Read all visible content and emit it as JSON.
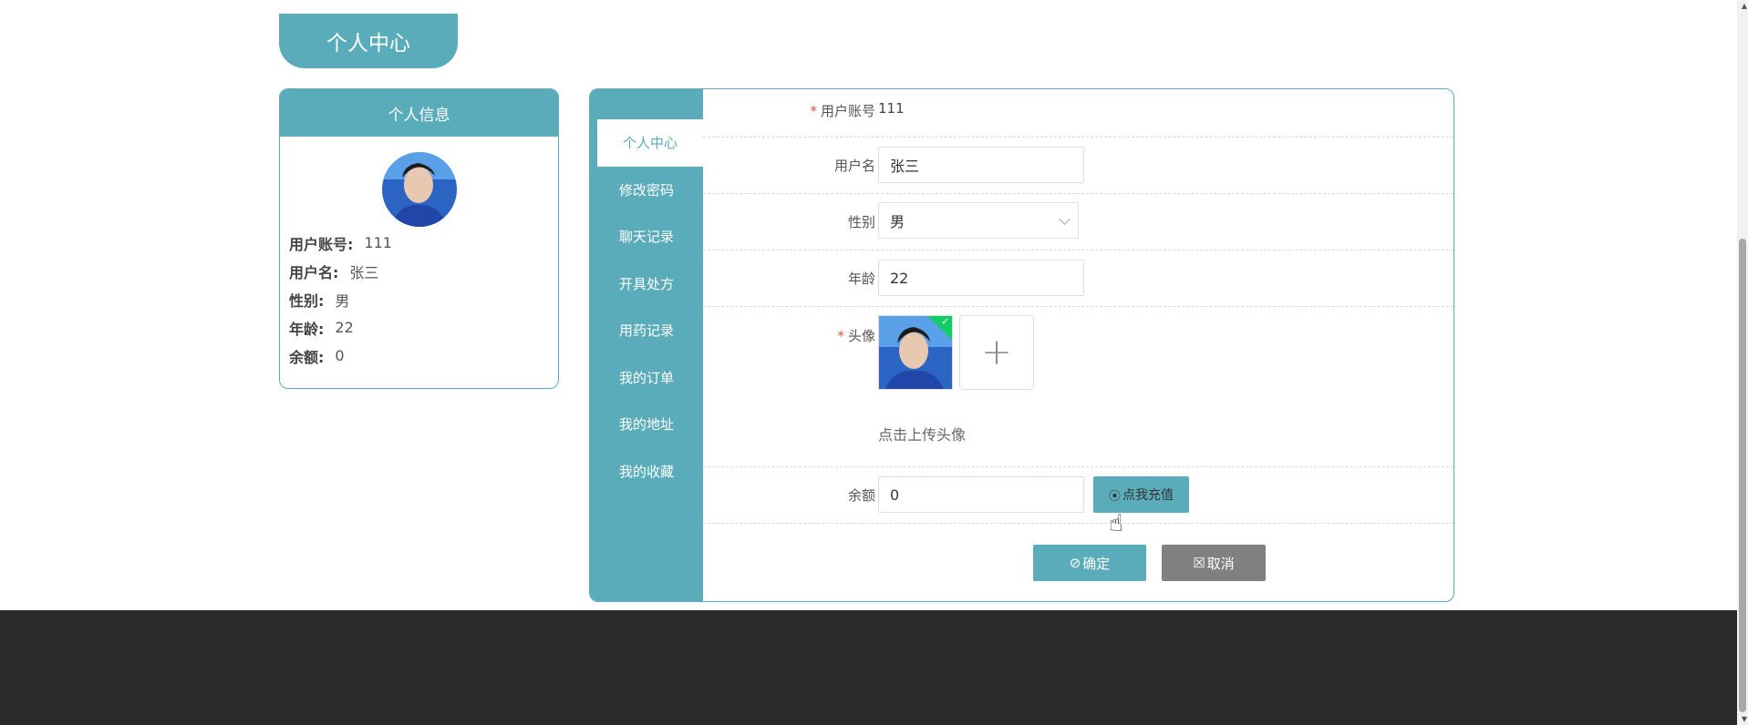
{
  "page_title": "个人中心",
  "info_card": {
    "title": "个人信息",
    "rows": [
      {
        "key": "用户账号:",
        "value": "111"
      },
      {
        "key": "用户名:",
        "value": "张三"
      },
      {
        "key": "性别:",
        "value": "男"
      },
      {
        "key": "年龄:",
        "value": "22"
      },
      {
        "key": "余额:",
        "value": "0"
      }
    ]
  },
  "side_nav": {
    "items": [
      "个人中心",
      "修改密码",
      "聊天记录",
      "开具处方",
      "用药记录",
      "我的订单",
      "我的地址",
      "我的收藏"
    ],
    "active_index": 0
  },
  "form": {
    "account_label": "用户账号",
    "account_value": "111",
    "username_label": "用户名",
    "username_value": "张三",
    "gender_label": "性别",
    "gender_value": "男",
    "age_label": "年龄",
    "age_value": "22",
    "avatar_label": "头像",
    "upload_hint": "点击上传头像",
    "balance_label": "余额",
    "balance_value": "0",
    "recharge_button": "点我充值",
    "ok_button": "确定",
    "cancel_button": "取消",
    "required_mark": "*"
  },
  "icons": {
    "recharge": "circle-dot-icon",
    "ok": "check-circle-icon",
    "cancel": "close-square-icon",
    "upload": "plus-icon"
  },
  "colors": {
    "accent": "#5aacba",
    "footer": "#2a2a2a",
    "cancel": "#808080",
    "required": "#e74c3c"
  }
}
